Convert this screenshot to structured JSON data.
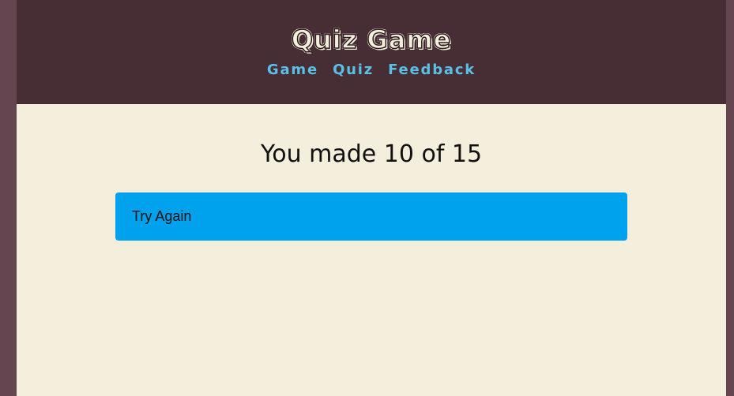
{
  "header": {
    "title": "Quiz Game",
    "nav": [
      {
        "label": "Game"
      },
      {
        "label": "Quiz"
      },
      {
        "label": "Feedback"
      }
    ]
  },
  "main": {
    "result_text": "You made 10 of 15",
    "try_again_label": "Try Again"
  },
  "colors": {
    "outer_background": "#654650",
    "header_background": "#472d34",
    "page_background": "#f4efdc",
    "nav_link": "#5bbfe6",
    "button_background": "#00a2ed"
  }
}
